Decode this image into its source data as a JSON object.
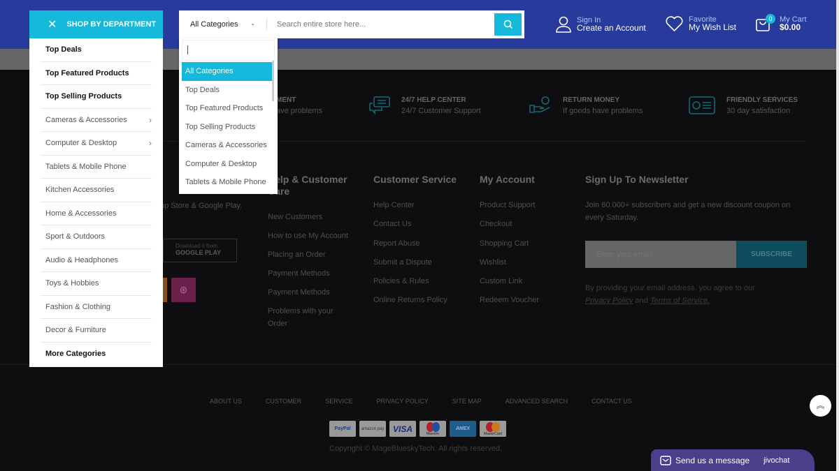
{
  "menu": {
    "title": "SHOP BY DEPARTMENT",
    "items": [
      {
        "label": "Top Deals",
        "bold": true
      },
      {
        "label": "Top Featured Products",
        "bold": true
      },
      {
        "label": "Top Selling Products",
        "bold": true
      },
      {
        "label": "Cameras & Accessories",
        "arrow": true
      },
      {
        "label": "Computer & Desktop",
        "arrow": true
      },
      {
        "label": "Tablets & Mobile Phone"
      },
      {
        "label": "Kitchen Accessories"
      },
      {
        "label": "Home & Accessories"
      },
      {
        "label": "Sport & Outdoors"
      },
      {
        "label": "Audio & Headphones"
      },
      {
        "label": "Toys & Hobbies"
      },
      {
        "label": "Fashion & Clothing"
      },
      {
        "label": "Decor & Furniture"
      },
      {
        "label": "More Categories",
        "bold": true
      }
    ]
  },
  "search": {
    "category": "All Categories",
    "placeholder": "Search entire store here...",
    "options": [
      "All Categories",
      "Top Deals",
      "Top Featured Products",
      "Top Selling Products",
      "Cameras & Accessories",
      "Computer & Desktop",
      "Tablets & Mobile Phone"
    ]
  },
  "header": {
    "signin": "Sign In",
    "account": "Create an Account",
    "favorite": "Favorite",
    "wishlist": "My Wish List",
    "cart_label": "My Cart",
    "cart_total": "$0.00",
    "cart_count": "0"
  },
  "features": [
    {
      "title": "MENT",
      "sub": "ave problems"
    },
    {
      "title": "24/7 HELP CENTER",
      "sub": "24/7 Customer Support"
    },
    {
      "title": "RETURN MONEY",
      "sub": "If goods have problems"
    },
    {
      "title": "FRIENDLY SERVICES",
      "sub": "30 day satisfaction"
    }
  ],
  "footer": {
    "app_text": "pp Store & Google Play.",
    "google_play": {
      "line1": "Download it from",
      "line2": "GOOGLE PLAY"
    },
    "cols": [
      {
        "title": "Help & Customer Care",
        "links": [
          "New Customers",
          "How to use My Account",
          "Placing an Order",
          "Payment Methods",
          "Payment Methods",
          "Problems with your Order"
        ]
      },
      {
        "title": "Customer Service",
        "links": [
          "Help Center",
          "Contact Us",
          "Report Abuse",
          "Submit a Dispute",
          "Policies & Rules",
          "Online Returns Policy"
        ]
      },
      {
        "title": "My Account",
        "links": [
          "Product Support",
          "Checkout",
          "Shopping Cart",
          "Wishlist",
          "Custom Link",
          "Redeem Voucher"
        ]
      }
    ],
    "newsletter": {
      "title": "Sign Up To Newsletter",
      "text": "Join 60.000+ subscribers and get a new discount coupon on every Saturday.",
      "placeholder": "Enter your email",
      "button": "SUBSCRIBE",
      "note": "By providing your email address, you agree to our",
      "privacy": "Privacy Policy",
      "and": "and",
      "terms": "Terms of Service."
    },
    "bottom_links": [
      "ABOUT US",
      "CUSTOMER",
      "SERVICE",
      "PRIVACY POLICY",
      "SITE MAP",
      "ADVANCED SEARCH",
      "CONTACT US"
    ],
    "payments": [
      "PayPal",
      "amazon pay",
      "VISA",
      "Maestro",
      "AMEX",
      "MasterCard"
    ],
    "copyright": "Copyright © MageBlueskyTech. All rights reserved."
  },
  "chat": {
    "label": "Send us a message",
    "brand": "jivochat"
  },
  "colors": {
    "header": "#283a9c",
    "accent": "#16b9dc",
    "chat": "#4b3f8c"
  }
}
